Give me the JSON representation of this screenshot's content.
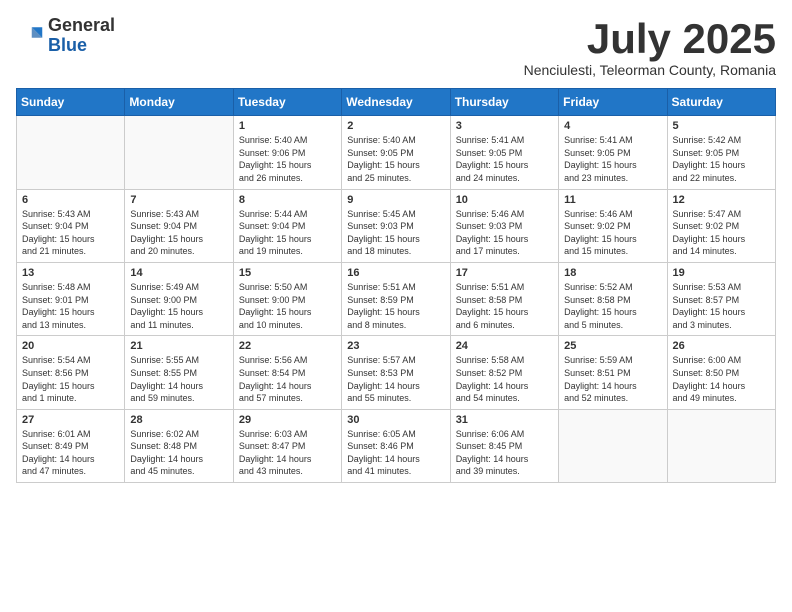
{
  "header": {
    "logo_general": "General",
    "logo_blue": "Blue",
    "month_title": "July 2025",
    "location": "Nenciulesti, Teleorman County, Romania"
  },
  "weekdays": [
    "Sunday",
    "Monday",
    "Tuesday",
    "Wednesday",
    "Thursday",
    "Friday",
    "Saturday"
  ],
  "weeks": [
    [
      {
        "day": "",
        "info": ""
      },
      {
        "day": "",
        "info": ""
      },
      {
        "day": "1",
        "info": "Sunrise: 5:40 AM\nSunset: 9:06 PM\nDaylight: 15 hours\nand 26 minutes."
      },
      {
        "day": "2",
        "info": "Sunrise: 5:40 AM\nSunset: 9:05 PM\nDaylight: 15 hours\nand 25 minutes."
      },
      {
        "day": "3",
        "info": "Sunrise: 5:41 AM\nSunset: 9:05 PM\nDaylight: 15 hours\nand 24 minutes."
      },
      {
        "day": "4",
        "info": "Sunrise: 5:41 AM\nSunset: 9:05 PM\nDaylight: 15 hours\nand 23 minutes."
      },
      {
        "day": "5",
        "info": "Sunrise: 5:42 AM\nSunset: 9:05 PM\nDaylight: 15 hours\nand 22 minutes."
      }
    ],
    [
      {
        "day": "6",
        "info": "Sunrise: 5:43 AM\nSunset: 9:04 PM\nDaylight: 15 hours\nand 21 minutes."
      },
      {
        "day": "7",
        "info": "Sunrise: 5:43 AM\nSunset: 9:04 PM\nDaylight: 15 hours\nand 20 minutes."
      },
      {
        "day": "8",
        "info": "Sunrise: 5:44 AM\nSunset: 9:04 PM\nDaylight: 15 hours\nand 19 minutes."
      },
      {
        "day": "9",
        "info": "Sunrise: 5:45 AM\nSunset: 9:03 PM\nDaylight: 15 hours\nand 18 minutes."
      },
      {
        "day": "10",
        "info": "Sunrise: 5:46 AM\nSunset: 9:03 PM\nDaylight: 15 hours\nand 17 minutes."
      },
      {
        "day": "11",
        "info": "Sunrise: 5:46 AM\nSunset: 9:02 PM\nDaylight: 15 hours\nand 15 minutes."
      },
      {
        "day": "12",
        "info": "Sunrise: 5:47 AM\nSunset: 9:02 PM\nDaylight: 15 hours\nand 14 minutes."
      }
    ],
    [
      {
        "day": "13",
        "info": "Sunrise: 5:48 AM\nSunset: 9:01 PM\nDaylight: 15 hours\nand 13 minutes."
      },
      {
        "day": "14",
        "info": "Sunrise: 5:49 AM\nSunset: 9:00 PM\nDaylight: 15 hours\nand 11 minutes."
      },
      {
        "day": "15",
        "info": "Sunrise: 5:50 AM\nSunset: 9:00 PM\nDaylight: 15 hours\nand 10 minutes."
      },
      {
        "day": "16",
        "info": "Sunrise: 5:51 AM\nSunset: 8:59 PM\nDaylight: 15 hours\nand 8 minutes."
      },
      {
        "day": "17",
        "info": "Sunrise: 5:51 AM\nSunset: 8:58 PM\nDaylight: 15 hours\nand 6 minutes."
      },
      {
        "day": "18",
        "info": "Sunrise: 5:52 AM\nSunset: 8:58 PM\nDaylight: 15 hours\nand 5 minutes."
      },
      {
        "day": "19",
        "info": "Sunrise: 5:53 AM\nSunset: 8:57 PM\nDaylight: 15 hours\nand 3 minutes."
      }
    ],
    [
      {
        "day": "20",
        "info": "Sunrise: 5:54 AM\nSunset: 8:56 PM\nDaylight: 15 hours\nand 1 minute."
      },
      {
        "day": "21",
        "info": "Sunrise: 5:55 AM\nSunset: 8:55 PM\nDaylight: 14 hours\nand 59 minutes."
      },
      {
        "day": "22",
        "info": "Sunrise: 5:56 AM\nSunset: 8:54 PM\nDaylight: 14 hours\nand 57 minutes."
      },
      {
        "day": "23",
        "info": "Sunrise: 5:57 AM\nSunset: 8:53 PM\nDaylight: 14 hours\nand 55 minutes."
      },
      {
        "day": "24",
        "info": "Sunrise: 5:58 AM\nSunset: 8:52 PM\nDaylight: 14 hours\nand 54 minutes."
      },
      {
        "day": "25",
        "info": "Sunrise: 5:59 AM\nSunset: 8:51 PM\nDaylight: 14 hours\nand 52 minutes."
      },
      {
        "day": "26",
        "info": "Sunrise: 6:00 AM\nSunset: 8:50 PM\nDaylight: 14 hours\nand 49 minutes."
      }
    ],
    [
      {
        "day": "27",
        "info": "Sunrise: 6:01 AM\nSunset: 8:49 PM\nDaylight: 14 hours\nand 47 minutes."
      },
      {
        "day": "28",
        "info": "Sunrise: 6:02 AM\nSunset: 8:48 PM\nDaylight: 14 hours\nand 45 minutes."
      },
      {
        "day": "29",
        "info": "Sunrise: 6:03 AM\nSunset: 8:47 PM\nDaylight: 14 hours\nand 43 minutes."
      },
      {
        "day": "30",
        "info": "Sunrise: 6:05 AM\nSunset: 8:46 PM\nDaylight: 14 hours\nand 41 minutes."
      },
      {
        "day": "31",
        "info": "Sunrise: 6:06 AM\nSunset: 8:45 PM\nDaylight: 14 hours\nand 39 minutes."
      },
      {
        "day": "",
        "info": ""
      },
      {
        "day": "",
        "info": ""
      }
    ]
  ]
}
